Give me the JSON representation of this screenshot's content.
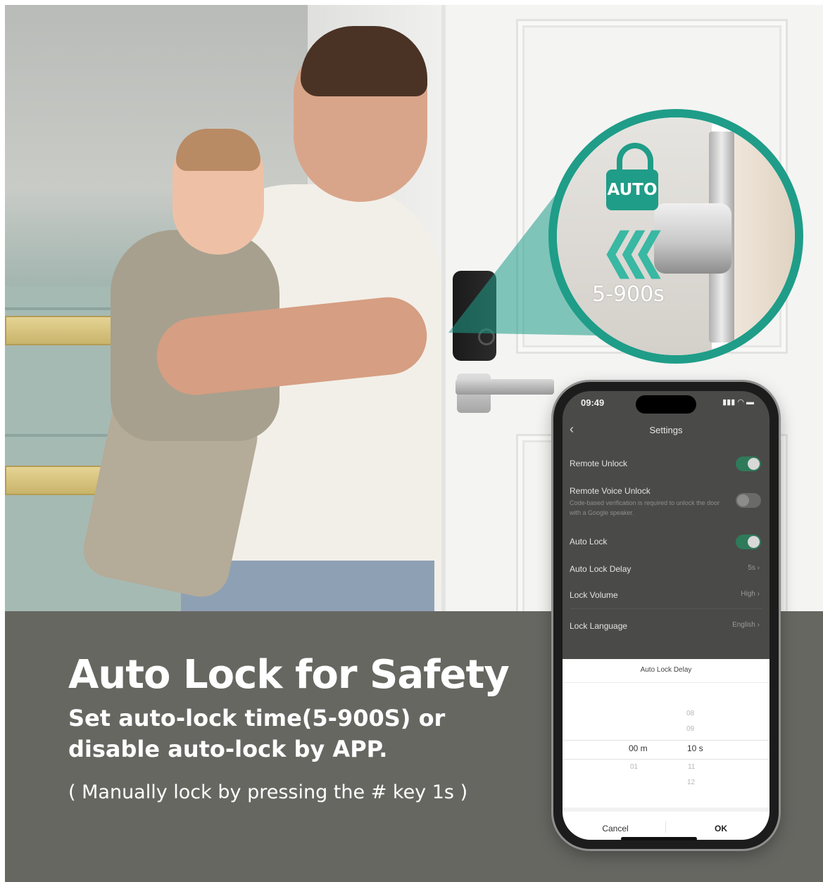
{
  "callout": {
    "badge": "AUTO",
    "range": "5-900s",
    "colors": {
      "accent": "#1f9d88"
    }
  },
  "promo": {
    "headline": "Auto Lock for Safety",
    "subline": "Set auto-lock time(5-900S) or disable auto-lock by APP.",
    "note": "( Manually lock by pressing the # key 1s )"
  },
  "phone": {
    "status": {
      "time": "09:49",
      "icons": "signal-icon wifi-icon battery-icon"
    },
    "nav": {
      "title": "Settings",
      "back_icon": "chevron-left-icon"
    },
    "settings": [
      {
        "label": "Remote Unlock",
        "toggle": true
      },
      {
        "label": "Remote Voice Unlock",
        "description": "Code-based verification is required to unlock the door with a Google speaker.",
        "toggle": false
      },
      {
        "label": "Auto Lock",
        "toggle": true
      },
      {
        "label": "Auto Lock Delay",
        "value": "5s"
      },
      {
        "label": "Lock Volume",
        "value": "High"
      },
      {
        "label": "Lock Language",
        "value": "English"
      }
    ],
    "sheet": {
      "title": "Auto Lock Delay",
      "minutes": {
        "selected": "00 m",
        "below": [
          "01"
        ]
      },
      "seconds": {
        "above": [
          "08",
          "09"
        ],
        "selected": "10 s",
        "below": [
          "11",
          "12"
        ]
      },
      "cancel": "Cancel",
      "ok": "OK"
    }
  }
}
